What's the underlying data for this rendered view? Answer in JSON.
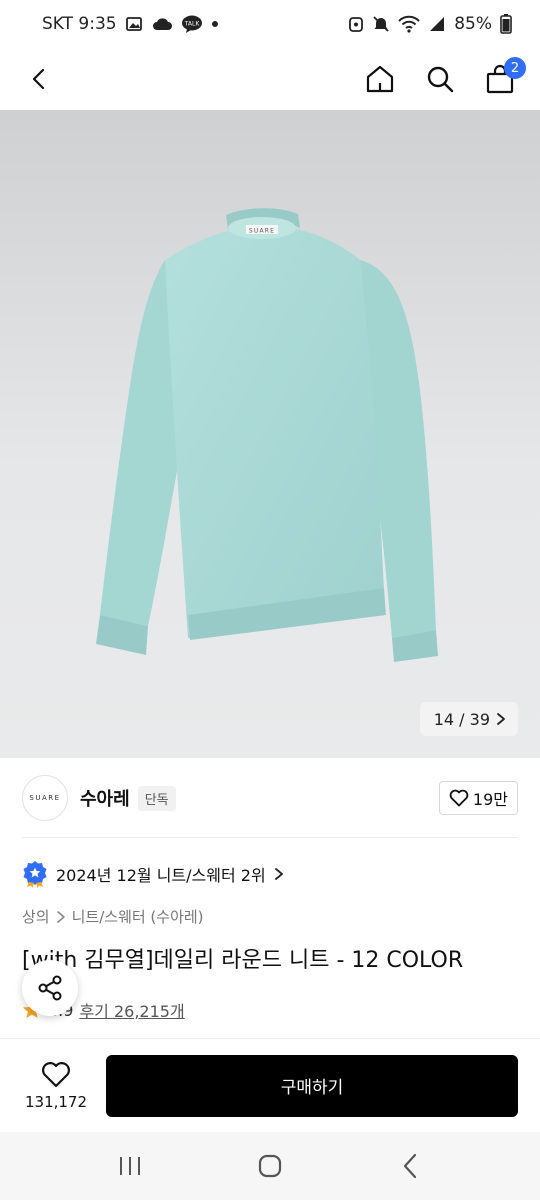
{
  "status_bar": {
    "carrier_time": "SKT 9:35",
    "battery": "85%"
  },
  "nav": {
    "cart_count": "2"
  },
  "hero": {
    "image_label": "SUARE",
    "counter": "14 / 39"
  },
  "brand": {
    "logo_text": "SUARE",
    "name": "수아레",
    "tag": "단독",
    "likes": "19만"
  },
  "ranking": {
    "text": "2024년 12월 니트/스웨터 2위"
  },
  "category": {
    "level1": "상의",
    "level2": "니트/스웨터 (수아레)"
  },
  "product": {
    "title": "[with 김무열]데일리 라운드 니트 - 12 COLOR",
    "rating": "4.9",
    "reviews": "후기 26,215개"
  },
  "bottom": {
    "wish_count": "131,172",
    "buy_label": "구매하기"
  },
  "colors": {
    "sweater": "#a9d9d6",
    "badge": "#2f6ef5",
    "star": "#f5a623"
  }
}
